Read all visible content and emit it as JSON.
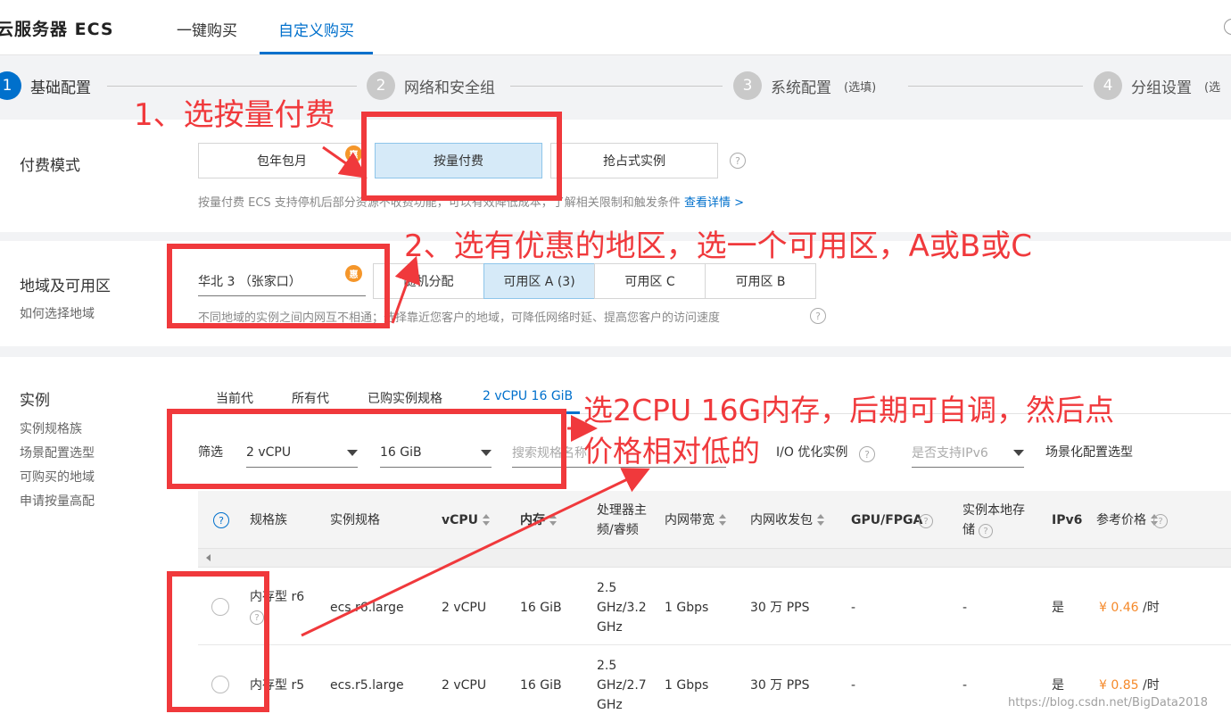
{
  "header": {
    "app_title": "云服务器 ECS",
    "tabs": [
      {
        "label": "一键购买"
      },
      {
        "label": "自定义购买"
      }
    ]
  },
  "steps": [
    {
      "num": "1",
      "label": "基础配置",
      "optional": ""
    },
    {
      "num": "2",
      "label": "网络和安全组",
      "optional": ""
    },
    {
      "num": "3",
      "label": "系统配置",
      "optional": "(选填)"
    },
    {
      "num": "4",
      "label": "分组设置",
      "optional": "(选"
    }
  ],
  "billing": {
    "title": "付费模式",
    "options": [
      {
        "label": "包年包月"
      },
      {
        "label": "按量付费"
      },
      {
        "label": "抢占式实例"
      }
    ],
    "badge": "惠",
    "hint": "按量付费 ECS 支持停机后部分资源不收费功能，可以有效降低成本，了解相关限制和触发条件",
    "hint_link": "查看详情 >"
  },
  "region": {
    "title": "地域及可用区",
    "subtitle": "如何选择地域",
    "selected_region": "华北 3 （张家口）",
    "badge": "惠",
    "zones": [
      {
        "label": "随机分配"
      },
      {
        "label": "可用区 A (3)"
      },
      {
        "label": "可用区 C"
      },
      {
        "label": "可用区 B"
      }
    ],
    "hint": "不同地域的实例之间内网互不相通；选择靠近您客户的地域，可降低网络时延、提高您客户的访问速度"
  },
  "instance": {
    "title": "实例",
    "side_links": [
      "实例规格族",
      "场景配置选型",
      "可购买的地域",
      "申请按量高配"
    ],
    "generation_tabs": [
      {
        "label": "当前代"
      },
      {
        "label": "所有代"
      },
      {
        "label": "已购实例规格"
      },
      {
        "label": "2 vCPU 16 GiB"
      }
    ],
    "filter": {
      "label": "筛选",
      "vcpu": "2 vCPU",
      "memory": "16 GiB",
      "search_placeholder": "搜索规格名称",
      "io_opt": "I/O 优化实例",
      "ipv6": "是否支持IPv6",
      "scene_link": "场景化配置选型"
    },
    "columns": {
      "family": "规格族",
      "spec": "实例规格",
      "vcpu": "vCPU",
      "memory": "内存",
      "clock_1": "处理器主",
      "clock_2": "频/睿频",
      "bandwidth": "内网带宽",
      "pps": "内网收发包",
      "gpu": "GPU/FPGA",
      "local_1": "实例本地存",
      "local_2": "储",
      "ipv6": "IPv6",
      "price": "参考价格"
    },
    "rows": [
      {
        "family": "内存型 r6",
        "spec": "ecs.r6.large",
        "vcpu": "2 vCPU",
        "memory": "16 GiB",
        "clock_1": "2.5",
        "clock_2": "GHz/3.2",
        "clock_3": "GHz",
        "bandwidth": "1 Gbps",
        "pps": "30 万 PPS",
        "gpu": "-",
        "local": "-",
        "ipv6": "是",
        "price": "¥ 0.46",
        "unit": "/时"
      },
      {
        "family": "内存型 r5",
        "spec": "ecs.r5.large",
        "vcpu": "2 vCPU",
        "memory": "16 GiB",
        "clock_1": "2.5",
        "clock_2": "GHz/2.7",
        "clock_3": "GHz",
        "bandwidth": "1 Gbps",
        "pps": "30 万 PPS",
        "gpu": "-",
        "local": "-",
        "ipv6": "是",
        "price": "¥ 0.85",
        "unit": "/时"
      }
    ]
  },
  "annotations": {
    "a1": "1、选按量付费",
    "a2": "2、选有优惠的地区，选一个可用区，A或B或C",
    "a3_line1": "选2CPU 16G内存，后期可自调，然后点",
    "a3_line2": "价格相对低的"
  },
  "watermark": "https://blog.csdn.net/BigData2018",
  "colors": {
    "accent": "#0070cc",
    "annotation": "#f0393c",
    "badge": "#f5962a",
    "price": "#f5892a"
  }
}
